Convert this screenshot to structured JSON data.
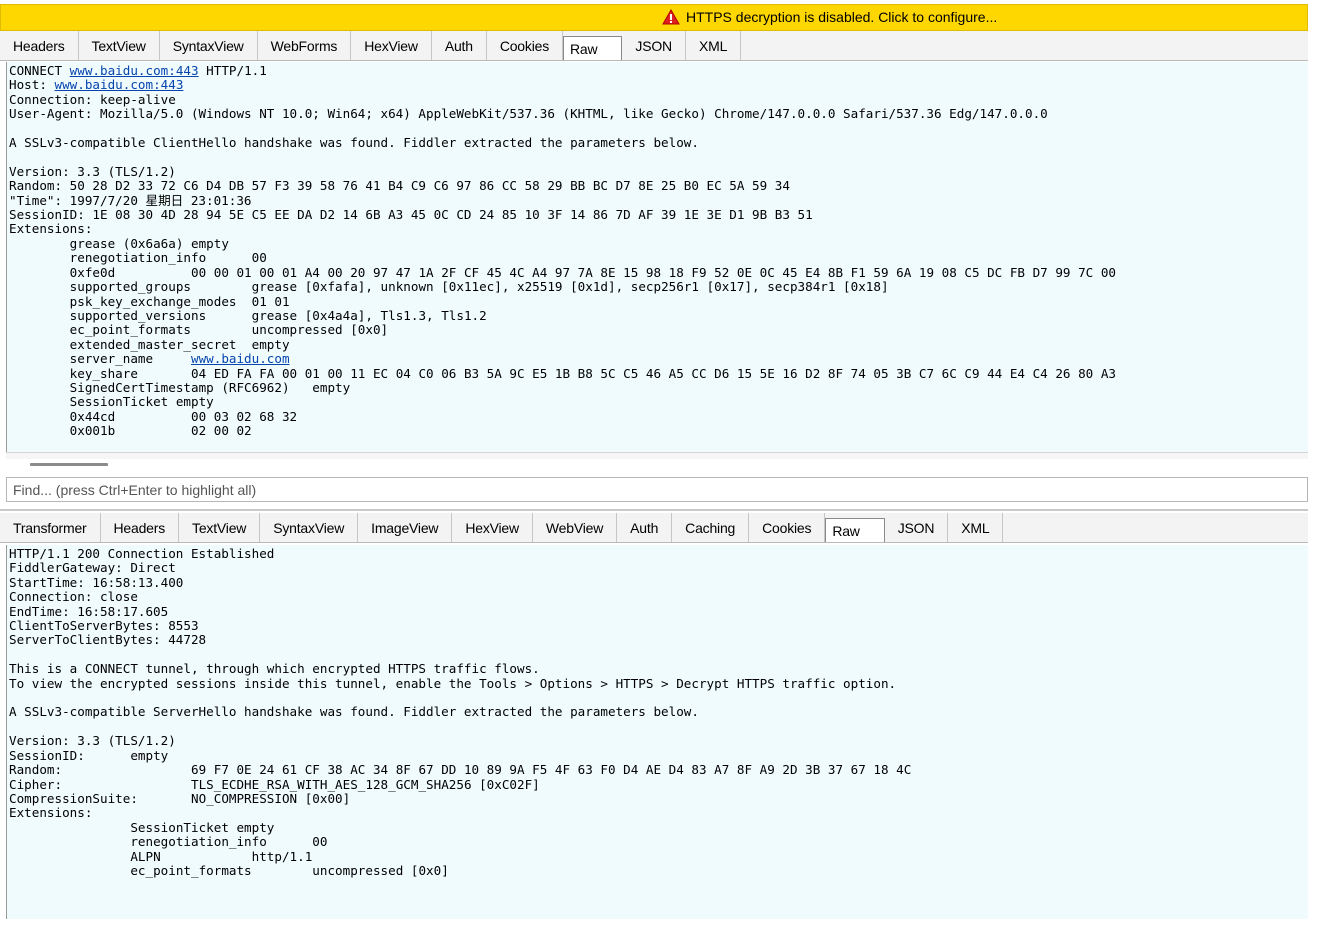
{
  "warning": {
    "text": "HTTPS decryption is disabled. Click to configure..."
  },
  "request_tabs": [
    "Headers",
    "TextView",
    "SyntaxView",
    "WebForms",
    "HexView",
    "Auth",
    "Cookies",
    "Raw",
    "JSON",
    "XML"
  ],
  "request_active_tab": "Raw",
  "request": {
    "line1_method": "CONNECT ",
    "line1_host": "www.baidu.com:443",
    "line1_proto": " HTTP/1.1",
    "host_label": "Host: ",
    "host_value": "www.baidu.com:443",
    "connection": "Connection: keep-alive",
    "user_agent": "User-Agent: Mozilla/5.0 (Windows NT 10.0; Win64; x64) AppleWebKit/537.36 (KHTML, like Gecko) Chrome/147.0.0.0 Safari/537.36 Edg/147.0.0.0",
    "handshake_note": "A SSLv3-compatible ClientHello handshake was found. Fiddler extracted the parameters below.",
    "version": "Version: 3.3 (TLS/1.2)",
    "random": "Random: 50 28 D2 33 72 C6 D4 DB 57 F3 39 58 76 41 B4 C9 C6 97 86 CC 58 29 BB BC D7 8E 25 B0 EC 5A 59 34",
    "time": "\"Time\": 1997/7/20 星期日 23:01:36",
    "session_id": "SessionID: 1E 08 30 4D 28 94 5E C5 EE DA D2 14 6B A3 45 0C CD 24 85 10 3F 14 86 7D AF 39 1E 3E D1 9B B3 51",
    "extensions_label": "Extensions:",
    "ext_grease": "\tgrease (0x6a6a)\tempty",
    "ext_renego": "\trenegotiation_info\t00",
    "ext_fe0d": "\t0xfe0d\t\t00 00 01 00 01 A4 00 20 97 47 1A 2F CF 45 4C A4 97 7A 8E 15 98 18 F9 52 0E 0C 45 E4 8B F1 59 6A 19 08 C5 DC FB D7 99 7C 00",
    "ext_groups": "\tsupported_groups\tgrease [0xfafa], unknown [0x11ec], x25519 [0x1d], secp256r1 [0x17], secp384r1 [0x18]",
    "ext_psk": "\tpsk_key_exchange_modes\t01 01",
    "ext_versions": "\tsupported_versions\tgrease [0x4a4a], Tls1.3, Tls1.2",
    "ext_ecpf": "\tec_point_formats\tuncompressed [0x0]",
    "ext_ems": "\textended_master_secret\tempty",
    "ext_sni_label": "\tserver_name\t",
    "ext_sni_value": "www.baidu.com",
    "ext_keyshare": "\tkey_share\t04 ED FA FA 00 01 00 11 EC 04 C0 06 B3 5A 9C E5 1B B8 5C C5 46 A5 CC D6 15 5E 16 D2 8F 74 05 3B C7 6C C9 44 E4 C4 26 80 A3",
    "ext_sct": "\tSignedCertTimestamp (RFC6962)\tempty",
    "ext_ticket": "\tSessionTicket empty",
    "ext_44cd": "\t0x44cd\t\t00 03 02 68 32",
    "ext_001b": "\t0x001b\t\t02 00 02"
  },
  "find_placeholder": "Find... (press Ctrl+Enter to highlight all)",
  "response_tabs": [
    "Transformer",
    "Headers",
    "TextView",
    "SyntaxView",
    "ImageView",
    "HexView",
    "WebView",
    "Auth",
    "Caching",
    "Cookies",
    "Raw",
    "JSON",
    "XML"
  ],
  "response_active_tab": "Raw",
  "response": {
    "status": "HTTP/1.1 200 Connection Established",
    "gateway": "FiddlerGateway: Direct",
    "start_time": "StartTime: 16:58:13.400",
    "connection": "Connection: close",
    "end_time": "EndTime: 16:58:17.605",
    "c2s_bytes": "ClientToServerBytes: 8553",
    "s2c_bytes": "ServerToClientBytes: 44728",
    "tunnel_note1": "This is a CONNECT tunnel, through which encrypted HTTPS traffic flows.",
    "tunnel_note2": "To view the encrypted sessions inside this tunnel, enable the Tools > Options > HTTPS > Decrypt HTTPS traffic option.",
    "handshake_note": "A SSLv3-compatible ServerHello handshake was found. Fiddler extracted the parameters below.",
    "version": "Version: 3.3 (TLS/1.2)",
    "session_id": "SessionID:\tempty",
    "random": "Random:\t\t\t69 F7 0E 24 61 CF 38 AC 34 8F 67 DD 10 89 9A F5 4F 63 F0 D4 AE D4 83 A7 8F A9 2D 3B 37 67 18 4C",
    "cipher": "Cipher:\t\t\tTLS_ECDHE_RSA_WITH_AES_128_GCM_SHA256 [0xC02F]",
    "compression": "CompressionSuite:\tNO_COMPRESSION [0x00]",
    "extensions_label": "Extensions:",
    "ext_ticket": "\t\tSessionTicket empty",
    "ext_renego": "\t\trenegotiation_info\t00",
    "ext_alpn": "\t\tALPN\t\thttp/1.1",
    "ext_ecpf": "\t\tec_point_formats\tuncompressed [0x0]"
  },
  "colors": {
    "warning_bg": "#ffd700",
    "pane_bg": "#f0fbfe",
    "link": "#0645ad"
  }
}
